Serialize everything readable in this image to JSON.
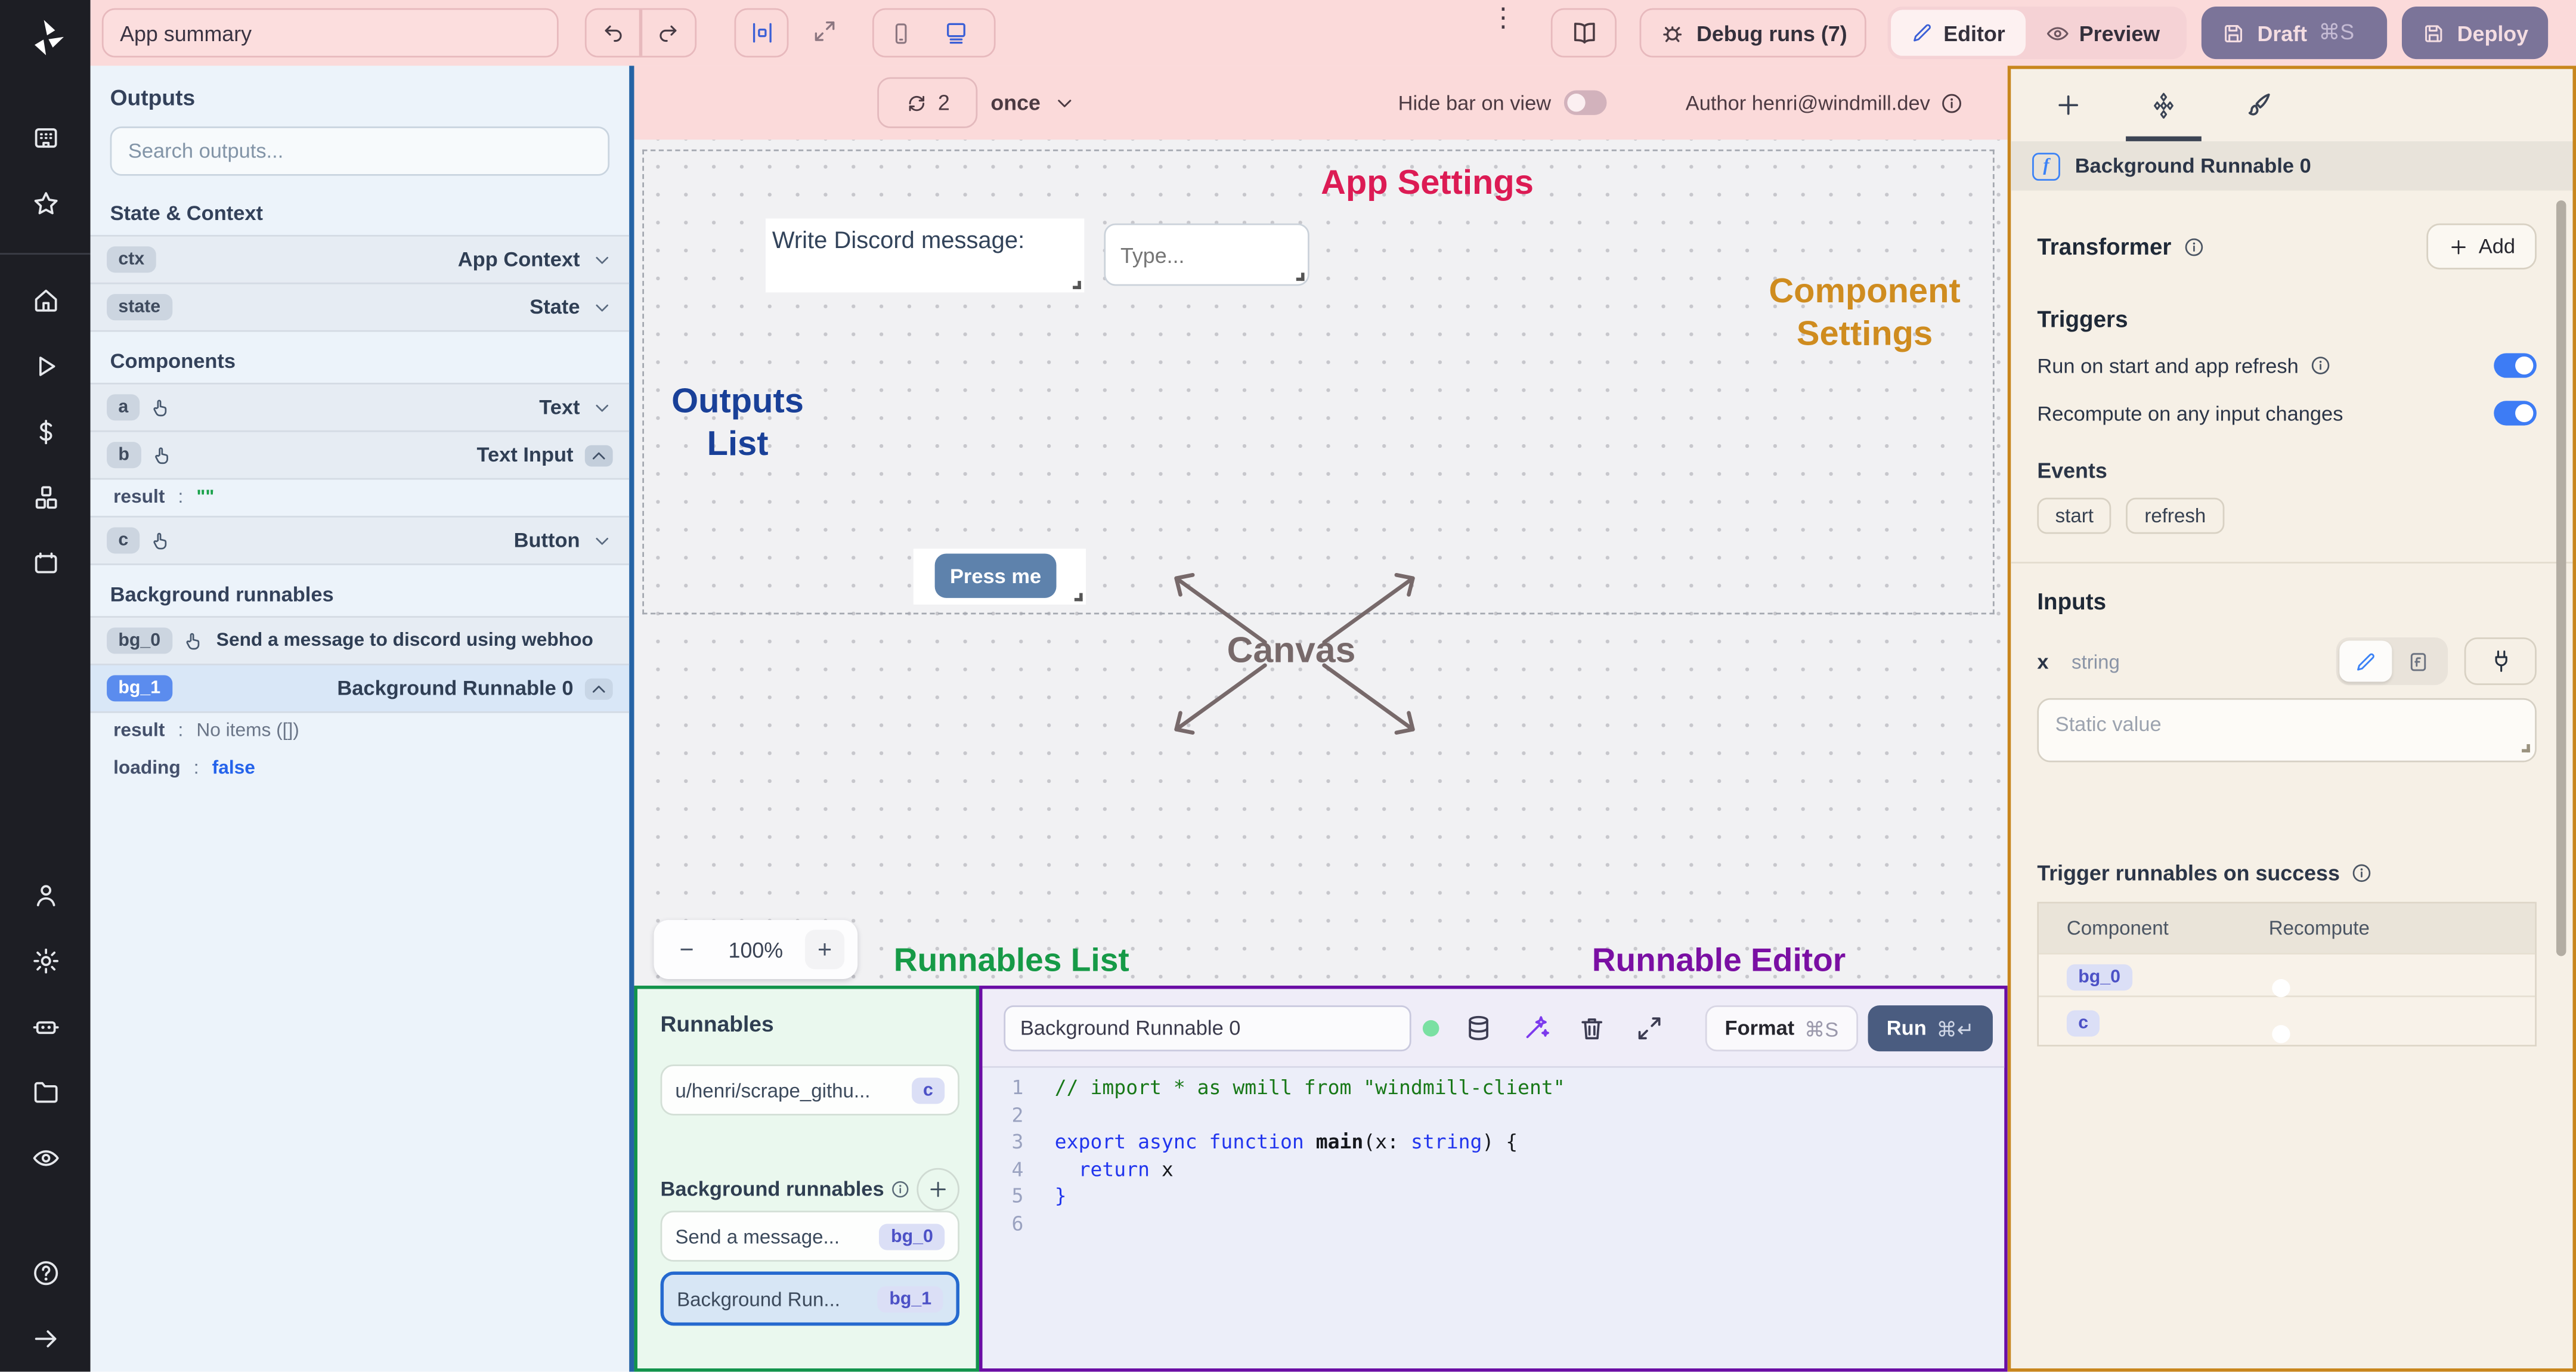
{
  "topbar": {
    "app_summary": "App summary",
    "debug_runs": "Debug runs (7)",
    "editor": "Editor",
    "preview": "Preview",
    "draft": "Draft",
    "draft_shortcut": "⌘S",
    "deploy": "Deploy"
  },
  "outputs": {
    "title": "Outputs",
    "search_placeholder": "Search outputs...",
    "state_heading": "State & Context",
    "ctx": {
      "id": "ctx",
      "type": "App Context"
    },
    "state": {
      "id": "state",
      "type": "State"
    },
    "components_heading": "Components",
    "comp_a": {
      "id": "a",
      "type": "Text"
    },
    "comp_b": {
      "id": "b",
      "type": "Text Input",
      "result_key": "result",
      "result_val": "\"\""
    },
    "comp_c": {
      "id": "c",
      "type": "Button"
    },
    "bg_heading": "Background runnables",
    "bg0": {
      "id": "bg_0",
      "label": "Send a message to discord using webhoo"
    },
    "bg1": {
      "id": "bg_1",
      "label": "Background Runnable 0",
      "result_key": "result",
      "result_val": "No items ([])",
      "loading_key": "loading",
      "loading_val": "false"
    }
  },
  "strip": {
    "refresh_count": "2",
    "mode": "once",
    "hide_bar": "Hide bar on view",
    "author": "Author henri@windmill.dev"
  },
  "canvas": {
    "labels": {
      "app_settings": "App Settings",
      "outputs_list_1": "Outputs",
      "outputs_list_2": "List",
      "component_1": "Component",
      "component_2": "Settings",
      "canvas": "Canvas",
      "runnables_list": "Runnables List",
      "runnable_editor": "Runnable Editor"
    },
    "discord_label": "Write Discord message:",
    "type_placeholder": "Type...",
    "press_me": "Press me",
    "zoom": "100%"
  },
  "runnables": {
    "title": "Runnables",
    "item_script": {
      "label": "u/henri/scrape_githu...",
      "badge": "c"
    },
    "bg_heading": "Background runnables",
    "item_bg0": {
      "label": "Send a message...",
      "badge": "bg_0"
    },
    "item_bg1": {
      "label": "Background Run...",
      "badge": "bg_1"
    }
  },
  "editor": {
    "name": "Background Runnable 0",
    "format": "Format",
    "format_shortcut": "⌘S",
    "run": "Run",
    "run_shortcut": "⌘↵",
    "gutter": {
      "g1": "1",
      "g2": "2",
      "g3": "3",
      "g4": "4",
      "g5": "5",
      "g6": "6"
    },
    "code": {
      "l1": "// import * as wmill from \"windmill-client\"",
      "l3_kw": "export async function ",
      "l3_fn": "main",
      "l3_p1": "(x: ",
      "l3_ty": "string",
      "l3_p2": ") {",
      "l4_kw": "  return",
      "l4_x": " x",
      "l5": "}"
    }
  },
  "panel": {
    "header": "Background Runnable 0",
    "transformer": "Transformer",
    "add": "Add",
    "triggers": "Triggers",
    "run_on_start": "Run on start and app refresh",
    "recompute_on": "Recompute on any input changes",
    "events": "Events",
    "event_start": "start",
    "event_refresh": "refresh",
    "inputs": "Inputs",
    "input_name": "x",
    "input_type": "string",
    "static_placeholder": "Static value",
    "trigger_success": "Trigger runnables on success",
    "table": {
      "col1": "Component",
      "col2": "Recompute",
      "rows": [
        {
          "badge": "bg_0"
        },
        {
          "badge": "c"
        }
      ]
    }
  },
  "colors": {
    "accent_blue": "#3d7cf5",
    "topbar_pink": "#fbdada",
    "outputs_border": "#2563a5",
    "runnables_border": "#12934b",
    "editor_border": "#6a0da4",
    "panel_border": "#c8861d",
    "label_app_settings": "#dc1b54",
    "label_outputs_list": "#194098",
    "label_component_settings": "#cf8c1f",
    "label_canvas": "#77696a",
    "label_runnables": "#169a47",
    "label_editor": "#7a0fa3"
  }
}
